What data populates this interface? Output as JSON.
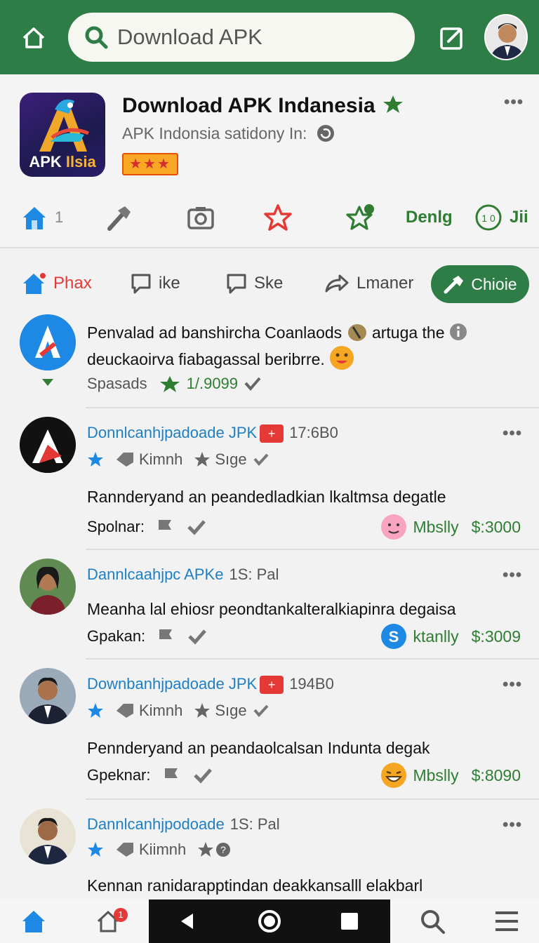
{
  "topbar": {
    "search_placeholder": "Download APK",
    "colors": {
      "bar": "#2e7d46"
    }
  },
  "app": {
    "icon_label_main": "APK ",
    "icon_label_accent": "Ilsia",
    "title": "Download APK Indanesia",
    "subtitle": "APK Indonsia satidony In:",
    "rating_stars": "★★★"
  },
  "tools": {
    "home_count": "1",
    "text_1": "Denlg",
    "text_2": "Jii"
  },
  "filters": [
    {
      "label": "Phax"
    },
    {
      "label": "ike"
    },
    {
      "label": "Ske"
    },
    {
      "label": "Lmaner"
    },
    {
      "label": "Chioie"
    }
  ],
  "pinned": {
    "text_line1": "Penvalad ad banshircha Coanlaods",
    "text_line1b": "artuga the",
    "text_line2": "deuckaoirva fiabagassal beribrre.",
    "meta_label": "Spasads",
    "meta_value": "1/.9099"
  },
  "posts": [
    {
      "author": "Donnlcanhjpadoade JPK",
      "time": "17:6B0",
      "meta_a": "Kimnh",
      "meta_b": "Sıge",
      "text": "Rannderyand  an peandedladkian lkaltmsa degatle",
      "foot_label": "Spolnar:",
      "foot_name": "Mbslly",
      "foot_price": "$:3000"
    },
    {
      "author": "Dannlcaahjpc APKe",
      "time": "1S: Pal",
      "text": "Meanha lal ehiosr peondtankalteralkiapinra degaisa",
      "foot_label": "Gpakan:",
      "foot_name": "ktanlly",
      "foot_price": "$:3009"
    },
    {
      "author": "Downbanhjpadoade JPK",
      "time": "194B0",
      "meta_a": "Kimnh",
      "meta_b": "Sıge",
      "text": "Pennderyand  an peandaolcalsan Indunta degak",
      "foot_label": "Gpeknar:",
      "foot_name": "Mbslly",
      "foot_price": "$:8090"
    },
    {
      "author": "Dannlcanhjpodoade",
      "time": "1S: Pal",
      "meta_a": "Kiimnh",
      "text": "Kennan ranidarapptindan deakkansalll elakbarl"
    }
  ],
  "bottom_nav": {
    "notif_count": "1"
  }
}
